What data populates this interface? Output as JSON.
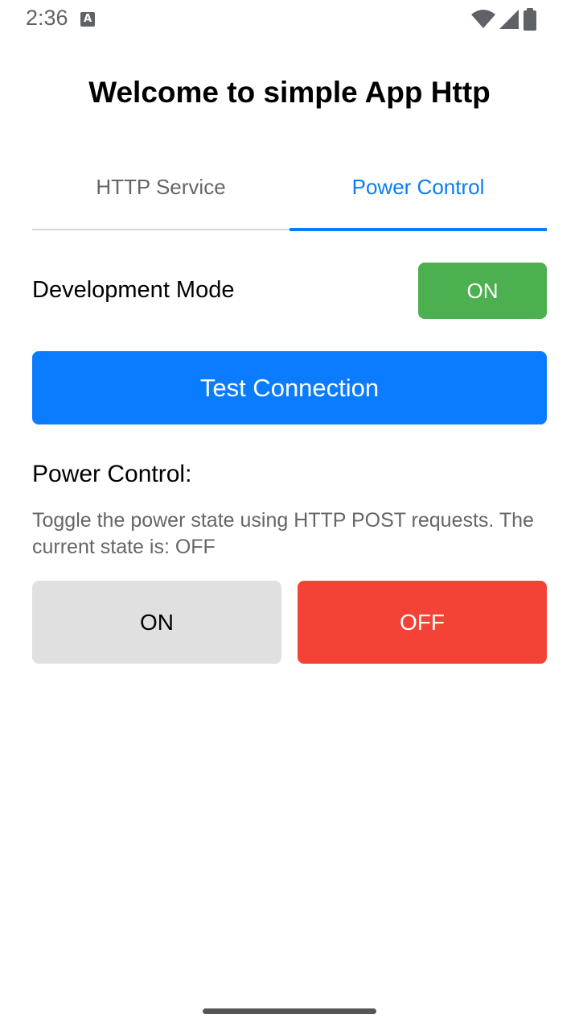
{
  "status_bar": {
    "time": "2:36",
    "notification_icon": "a-icon",
    "icons": [
      "wifi-icon",
      "cell-signal-icon",
      "battery-icon"
    ]
  },
  "header": {
    "title": "Welcome to simple App Http"
  },
  "tabs": [
    {
      "label": "HTTP Service",
      "active": false
    },
    {
      "label": "Power Control",
      "active": true
    }
  ],
  "dev_mode": {
    "label": "Development Mode",
    "toggle_label": "ON",
    "toggle_color": "#4caf50"
  },
  "test_connection": {
    "label": "Test Connection",
    "color": "#0a7cff"
  },
  "power_control": {
    "heading": "Power Control:",
    "description": "Toggle the power state using HTTP POST requests. The current state is: OFF",
    "on_label": "ON",
    "off_label": "OFF",
    "on_color": "#e0e0e0",
    "off_color": "#f44336"
  },
  "colors": {
    "accent": "#0a7cf5"
  }
}
